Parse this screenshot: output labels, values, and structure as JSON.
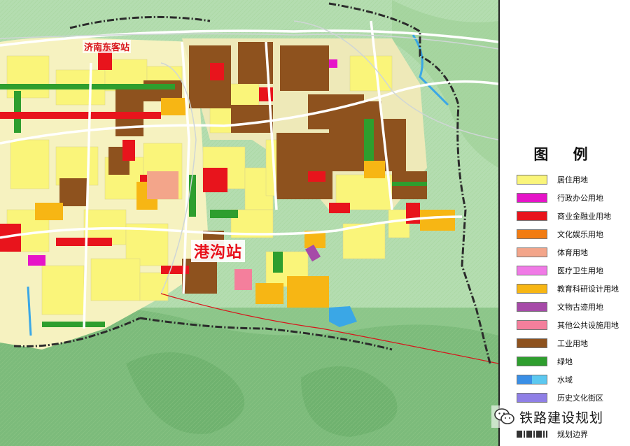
{
  "map": {
    "station_labels": {
      "jinan_east": "济南东客站",
      "ganggou": "港沟站"
    }
  },
  "legend": {
    "title": "图 例",
    "items": [
      {
        "label": "居住用地",
        "color": "#faf57a"
      },
      {
        "label": "行政办公用地",
        "color": "#e614c8"
      },
      {
        "label": "商业金融业用地",
        "color": "#e8141c"
      },
      {
        "label": "文化娱乐用地",
        "color": "#f27c12"
      },
      {
        "label": "体育用地",
        "color": "#f3a58a"
      },
      {
        "label": "医疗卫生用地",
        "color": "#f07ae6"
      },
      {
        "label": "教育科研设计用地",
        "color": "#f7b614"
      },
      {
        "label": "文物古迹用地",
        "color": "#a64aa8"
      },
      {
        "label": "其他公共设施用地",
        "color": "#f47f9c"
      },
      {
        "label": "工业用地",
        "color": "#8e521e"
      },
      {
        "label": "绿地",
        "color": "#2e9e2e"
      },
      {
        "label": "水域",
        "color": "#3aa7e6"
      },
      {
        "label": "历史文化街区",
        "color": "#8f7fe6"
      },
      {
        "label": "",
        "color": "#ffffff"
      },
      {
        "label": "规划边界",
        "color": "#333333"
      }
    ]
  },
  "watermark": {
    "text": "铁路建设规划",
    "icon": "wechat-icon"
  }
}
